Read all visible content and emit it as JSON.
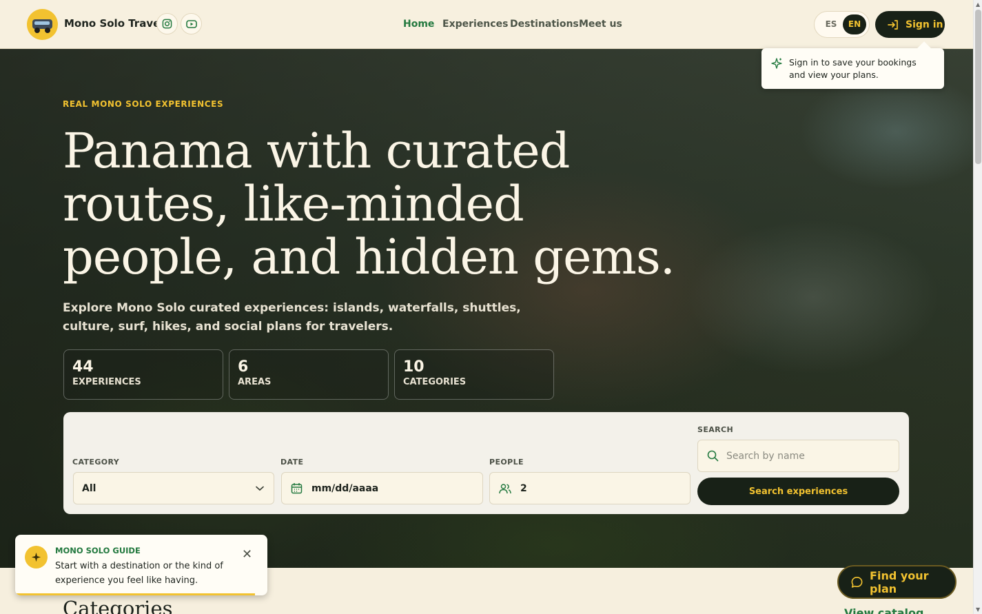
{
  "header": {
    "brand": "Mono Solo Travel",
    "nav": [
      {
        "label": "Home",
        "active": true
      },
      {
        "label": "Experiences",
        "active": false
      },
      {
        "label": "Destinations",
        "active": false
      },
      {
        "label": "Meet us",
        "active": false
      }
    ],
    "lang": {
      "es": "ES",
      "en": "EN",
      "selected": "EN"
    },
    "signin_label": "Sign in",
    "icons": {
      "instagram": "instagram-icon",
      "youtube": "youtube-icon",
      "signin": "sign-in-arrow-icon"
    }
  },
  "signin_tooltip": "Sign in to save your bookings and view your plans.",
  "hero": {
    "eyebrow": "REAL MONO SOLO EXPERIENCES",
    "headline": "Panama with curated routes, like-minded people, and hidden gems.",
    "subtitle": "Explore Mono Solo curated experiences: islands, waterfalls, shuttles, culture, surf, hikes, and social plans for travelers.",
    "stats": [
      {
        "value": "44",
        "label": "EXPERIENCES"
      },
      {
        "value": "6",
        "label": "AREAS"
      },
      {
        "value": "10",
        "label": "CATEGORIES"
      }
    ]
  },
  "search": {
    "category_label": "CATEGORY",
    "category_value": "All",
    "date_label": "DATE",
    "date_value": "mm/dd/aaaa",
    "people_label": "PEOPLE",
    "people_value": "2",
    "search_label": "SEARCH",
    "search_placeholder": "Search by name",
    "submit_label": "Search experiences"
  },
  "guide": {
    "title": "MONO SOLO GUIDE",
    "message": "Start with a destination or the kind of experience you feel like having."
  },
  "categories": {
    "title": "Categories",
    "view_catalog": "View catalog"
  },
  "find_plan_label": "Find your plan",
  "colors": {
    "accent": "#f2c230",
    "dark": "#182117",
    "green": "#23793f",
    "cream": "#f7f0df"
  }
}
